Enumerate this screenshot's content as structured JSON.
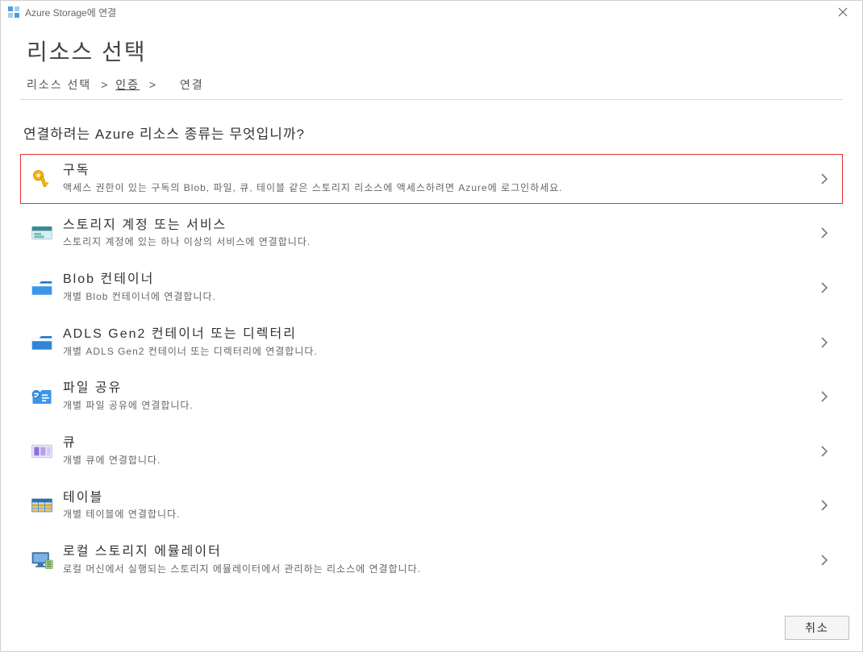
{
  "window": {
    "title": "Azure Storage에 연결"
  },
  "page": {
    "heading": "리소스 선택",
    "breadcrumb": {
      "step1": "리소스 선택",
      "step2": "인증",
      "step3": "연결",
      "sep": ">"
    },
    "question": "연결하려는 Azure 리소스 종류는 무엇입니까?"
  },
  "options": [
    {
      "key": "subscription",
      "title": "구독",
      "desc": "액세스 권한이 있는 구독의 Blob, 파일, 큐, 테이블 같은 스토리지 리소스에 액세스하려면 Azure에 로그인하세요.",
      "highlighted": true,
      "icon": "key-icon"
    },
    {
      "key": "storage-account",
      "title": "스토리지 계정 또는 서비스",
      "desc": "스토리지 계정에 있는 하나 이상의 서비스에 연결합니다.",
      "highlighted": false,
      "icon": "storage-icon"
    },
    {
      "key": "blob-container",
      "title": "Blob 컨테이너",
      "desc": "개별 Blob 컨테이너에 연결합니다.",
      "highlighted": false,
      "icon": "folder-blue-icon"
    },
    {
      "key": "adls-gen2",
      "title": "ADLS Gen2 컨테이너 또는 디렉터리",
      "desc": "개별 ADLS Gen2 컨테이너 또는 디렉터리에 연결합니다.",
      "highlighted": false,
      "icon": "folder-adls-icon"
    },
    {
      "key": "file-share",
      "title": "파일 공유",
      "desc": "개별 파일 공유에 연결합니다.",
      "highlighted": false,
      "icon": "file-share-icon"
    },
    {
      "key": "queue",
      "title": "큐",
      "desc": "개별 큐에 연결합니다.",
      "highlighted": false,
      "icon": "queue-icon"
    },
    {
      "key": "table",
      "title": "테이블",
      "desc": "개별 테이블에 연결합니다.",
      "highlighted": false,
      "icon": "table-icon"
    },
    {
      "key": "local-emulator",
      "title": "로컬 스토리지 에뮬레이터",
      "desc": "로컬 머신에서 실행되는 스토리지 에뮬레이터에서 관리하는 리소스에 연결합니다.",
      "highlighted": false,
      "icon": "monitor-icon"
    }
  ],
  "footer": {
    "cancel_label": "취소"
  }
}
